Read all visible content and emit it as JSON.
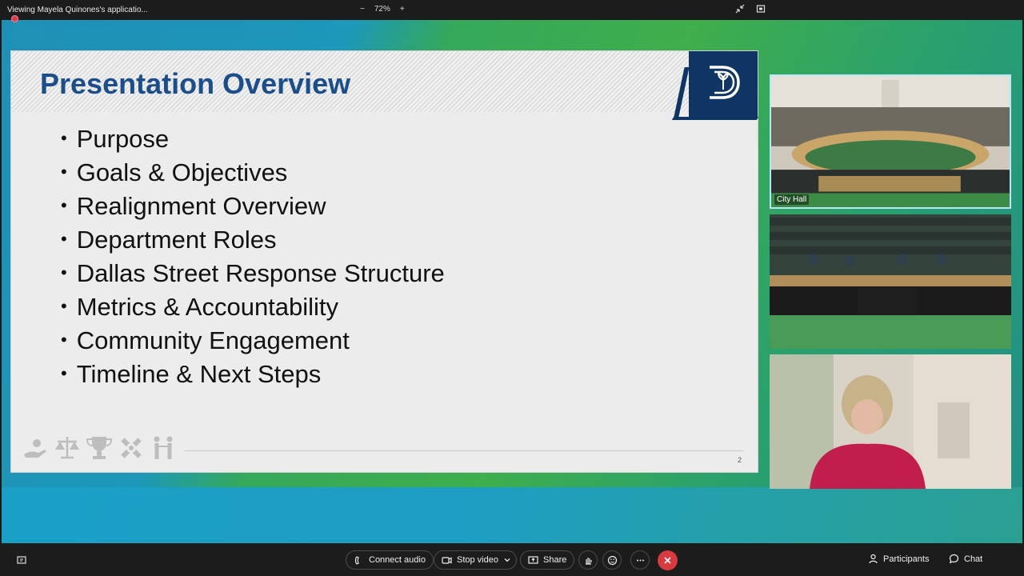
{
  "topbar": {
    "title": "Viewing Mayela Quinones's applicatio...",
    "zoom_out": "−",
    "zoom_level": "72%",
    "zoom_in": "+"
  },
  "slide": {
    "title": "Presentation Overview",
    "bullets": [
      "Purpose",
      "Goals & Objectives",
      "Realignment Overview",
      "Department Roles",
      "Dallas Street Response Structure",
      "Metrics & Accountability",
      "Community Engagement",
      "Timeline & Next Steps"
    ],
    "page_number": "2"
  },
  "videos": {
    "tile1_label": "City Hall"
  },
  "toolbar": {
    "connect_audio": "Connect audio",
    "stop_video": "Stop video",
    "share": "Share",
    "participants": "Participants",
    "chat": "Chat"
  },
  "colors": {
    "slide_title": "#1b4e8a",
    "logo_bg": "#0f3565",
    "end_call": "#d93a40"
  }
}
